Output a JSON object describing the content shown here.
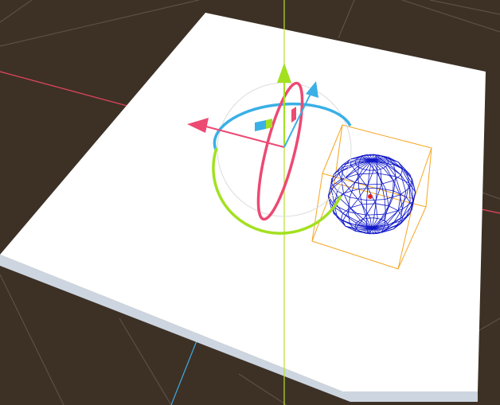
{
  "viewport": {
    "background": "#3d3126",
    "grid_line_color": "#5c5046",
    "x_axis_color": "#e8455f",
    "z_axis_color": "#3fa9e0",
    "y_axis_color": "#b8e02a"
  },
  "plane": {
    "top_color": "#ffffff",
    "side_color": "#cdd6e0"
  },
  "gizmo": {
    "x_color": "#ec4a73",
    "y_color": "#a3e020",
    "z_color": "#3ab0e6",
    "outer_ring_color": "#dddddd"
  },
  "selection_box": {
    "color": "#f5a623"
  },
  "sphere_wireframe": {
    "color": "#1018c8",
    "pivot_color": "#e02020"
  },
  "icons": {
    "translate_arrow": "arrow-icon",
    "rotate_ring": "ring-icon",
    "plane_handle": "plane-handle-icon"
  }
}
